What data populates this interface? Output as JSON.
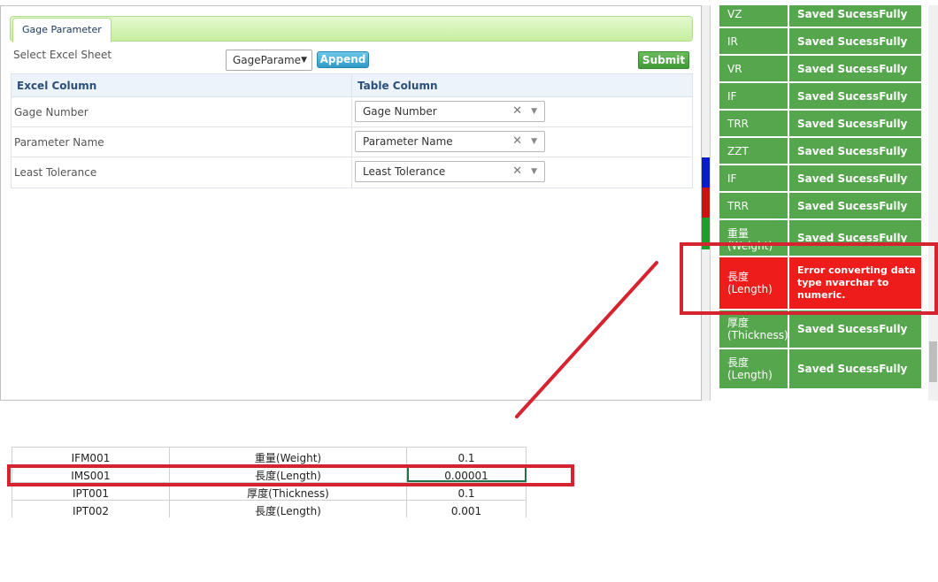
{
  "tab": {
    "label": "Gage Parameter"
  },
  "sheet": {
    "label": "Select Excel Sheet",
    "value": "GageParame"
  },
  "buttons": {
    "append": "Append",
    "submit": "Submit"
  },
  "mapping": {
    "headers": {
      "excel": "Excel Column",
      "table": "Table Column"
    },
    "rows": [
      {
        "excel": "Gage Number",
        "table": "Gage Number"
      },
      {
        "excel": "Parameter Name",
        "table": "Parameter Name"
      },
      {
        "excel": "Least Tolerance",
        "table": "Least Tolerance"
      }
    ]
  },
  "status": {
    "rows": [
      {
        "col": "VZ",
        "msg": "Saved SucessFully"
      },
      {
        "col": "IR",
        "msg": "Saved SucessFully"
      },
      {
        "col": "VR",
        "msg": "Saved SucessFully"
      },
      {
        "col": "IF",
        "msg": "Saved SucessFully"
      },
      {
        "col": "TRR",
        "msg": "Saved SucessFully"
      },
      {
        "col": "ZZT",
        "msg": "Saved SucessFully"
      },
      {
        "col": "IF",
        "msg": "Saved SucessFully"
      },
      {
        "col": "TRR",
        "msg": "Saved SucessFully"
      },
      {
        "col": "重量 (Weight)",
        "msg": "Saved SucessFully"
      },
      {
        "col": "長度 (Length)",
        "msg": "Error converting data type nvarchar to numeric."
      },
      {
        "col": "厚度 (Thickness)",
        "msg": "Saved SucessFully"
      },
      {
        "col": "長度 (Length)",
        "msg": "Saved SucessFully"
      }
    ]
  },
  "excel": {
    "rows": [
      {
        "code": "IFM001",
        "param": "重量(Weight)",
        "value": "0.1"
      },
      {
        "code": "IMS001",
        "param": "長度(Length)",
        "value": "0.00001"
      },
      {
        "code": "IPT001",
        "param": "厚度(Thickness)",
        "value": "0.1"
      },
      {
        "code": "IPT002",
        "param": "長度(Length)",
        "value": "0.001"
      }
    ]
  },
  "colors": {
    "success": "#56a64d",
    "error": "#ef1c1c",
    "annotation": "#d62330",
    "tab_green": "#c6eea0"
  }
}
